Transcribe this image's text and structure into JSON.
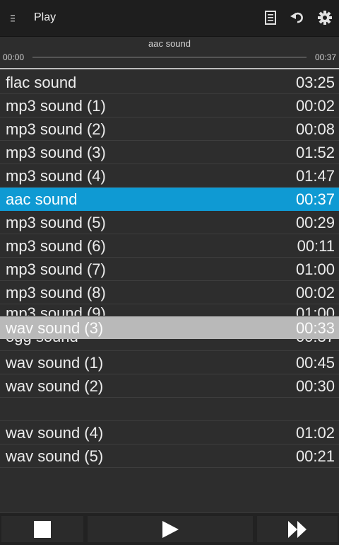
{
  "actionbar": {
    "title": "Play",
    "icons": [
      "menu-icon",
      "document-icon",
      "undo-icon",
      "gear-icon"
    ]
  },
  "player": {
    "now_playing": "aac sound",
    "elapsed": "00:00",
    "duration": "00:37",
    "progress": 0
  },
  "tracks": [
    {
      "name": "flac sound",
      "duration": "03:25"
    },
    {
      "name": "mp3 sound (1)",
      "duration": "00:02"
    },
    {
      "name": "mp3 sound (2)",
      "duration": "00:08"
    },
    {
      "name": "mp3 sound (3)",
      "duration": "01:52"
    },
    {
      "name": "mp3 sound (4)",
      "duration": "01:47"
    },
    {
      "name": "aac sound",
      "duration": "00:37",
      "selected": true
    },
    {
      "name": "mp3 sound (5)",
      "duration": "00:29"
    },
    {
      "name": "mp3 sound (6)",
      "duration": "00:11"
    },
    {
      "name": "mp3 sound (7)",
      "duration": "01:00"
    },
    {
      "name": "mp3 sound (8)",
      "duration": "00:02"
    },
    {
      "name": "mp3 sound (9)",
      "duration": "01:00"
    },
    {
      "name": "ogg sound",
      "duration": "00:37"
    },
    {
      "name": "wav sound (1)",
      "duration": "00:45"
    },
    {
      "name": "wav sound (2)",
      "duration": "00:30"
    },
    {
      "name": "wav sound (4)",
      "duration": "01:02"
    },
    {
      "name": "wav sound (5)",
      "duration": "00:21"
    }
  ],
  "dragging": {
    "name": "wav sound (3)",
    "duration": "00:33"
  },
  "controls": {
    "icons": [
      "stop-icon",
      "play-icon",
      "fast-forward-icon"
    ]
  },
  "colors": {
    "selected": "#0f9ad3",
    "background": "#2d2d2d",
    "actionbar": "#1e1e1e"
  }
}
